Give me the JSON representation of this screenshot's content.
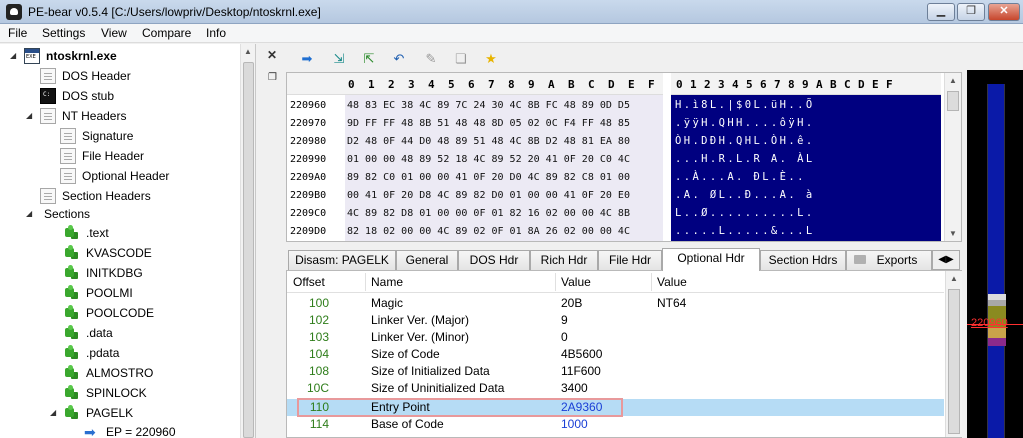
{
  "window": {
    "title": "PE-bear v0.5.4 [C:/Users/lowpriv/Desktop/ntoskrnl.exe]",
    "min_glyph": "▁",
    "max_glyph": "❐",
    "close_glyph": "✕"
  },
  "menu": [
    "File",
    "Settings",
    "View",
    "Compare",
    "Info"
  ],
  "tree": {
    "root": "ntoskrnl.exe",
    "items": [
      {
        "label": "DOS Header"
      },
      {
        "label": "DOS stub"
      },
      {
        "label": "NT Headers"
      },
      {
        "label": "Signature"
      },
      {
        "label": "File Header"
      },
      {
        "label": "Optional Header"
      },
      {
        "label": "Section Headers"
      },
      {
        "label": "Sections"
      },
      {
        "label": ".text"
      },
      {
        "label": "KVASCODE"
      },
      {
        "label": "INITKDBG"
      },
      {
        "label": "POOLMI"
      },
      {
        "label": "POOLCODE"
      },
      {
        "label": ".data"
      },
      {
        "label": ".pdata"
      },
      {
        "label": "ALMOSTRO"
      },
      {
        "label": "SPINLOCK"
      },
      {
        "label": "PAGELK"
      },
      {
        "label": "EP = 220960"
      }
    ]
  },
  "toolbar": {
    "icons": [
      "arrow-right-icon",
      "goto-icon",
      "export-icon",
      "undo-icon",
      "pin-icon",
      "copy-icon",
      "star-icon"
    ]
  },
  "hex": {
    "columns": [
      "0",
      "1",
      "2",
      "3",
      "4",
      "5",
      "6",
      "7",
      "8",
      "9",
      "A",
      "B",
      "C",
      "D",
      "E",
      "F"
    ],
    "rows": [
      {
        "addr": "220960",
        "bytes": "48 83 EC 38 4C 89 7C 24 30 4C 8B FC 48 89 0D D5",
        "ascii": "H.ì8L.|$0L.üH..Õ"
      },
      {
        "addr": "220970",
        "bytes": "9D FF FF 48 8B 51 48 48 8D 05 02 0C F4 FF 48 85",
        "ascii": ".ÿÿH.QHH....ôÿH."
      },
      {
        "addr": "220980",
        "bytes": "D2 48 0F 44 D0 48 89 51 48 4C 8B D2 48 81 EA 80",
        "ascii": "ÒH.DÐH.QHL.ÒH.ê."
      },
      {
        "addr": "220990",
        "bytes": "01 00 00 48 89 52 18 4C 89 52 20 41 0F 20 C0 4C",
        "ascii": "...H.R.L.R A. ÀL"
      },
      {
        "addr": "2209A0",
        "bytes": "89 82 C0 01 00 00 41 0F 20 D0 4C 89 82 C8 01 00",
        "ascii": "..À...A. ÐL.È.."
      },
      {
        "addr": "2209B0",
        "bytes": "00 41 0F 20 D8 4C 89 82 D0 01 00 00 41 0F 20 E0",
        "ascii": ".A. ØL..Ð...A. à"
      },
      {
        "addr": "2209C0",
        "bytes": "4C 89 82 D8 01 00 00 0F 01 82 16 02 00 00 4C 8B",
        "ascii": "L..Ø..........L."
      },
      {
        "addr": "2209D0",
        "bytes": "82 18 02 00 00 4C 89 02 0F 01 8A 26 02 00 00 4C",
        "ascii": ".....L.....&...L"
      }
    ]
  },
  "tabs": [
    {
      "label": "Disasm: PAGELK"
    },
    {
      "label": "General"
    },
    {
      "label": "DOS Hdr"
    },
    {
      "label": "Rich Hdr"
    },
    {
      "label": "File Hdr"
    },
    {
      "label": "Optional Hdr"
    },
    {
      "label": "Section Hdrs"
    },
    {
      "label": "Exports"
    }
  ],
  "table": {
    "headers": [
      "Offset",
      "Name",
      "Value",
      "Value"
    ],
    "rows": [
      {
        "offset": "100",
        "name": "Magic",
        "value": "20B",
        "value2": "NT64"
      },
      {
        "offset": "102",
        "name": "Linker Ver. (Major)",
        "value": "9",
        "value2": ""
      },
      {
        "offset": "103",
        "name": "Linker Ver. (Minor)",
        "value": "0",
        "value2": ""
      },
      {
        "offset": "104",
        "name": "Size of Code",
        "value": "4B5600",
        "value2": ""
      },
      {
        "offset": "108",
        "name": "Size of Initialized Data",
        "value": "11F600",
        "value2": ""
      },
      {
        "offset": "10C",
        "name": "Size of Uninitialized Data",
        "value": "3400",
        "value2": ""
      },
      {
        "offset": "110",
        "name": "Entry Point",
        "value": "2A9360",
        "value2": ""
      },
      {
        "offset": "114",
        "name": "Base of Code",
        "value": "1000",
        "value2": ""
      }
    ]
  },
  "overview": {
    "marker": "220960"
  },
  "colors": {
    "ascii_bg": "#000080",
    "offset_green": "#2e7d1a",
    "selected_row": "#b6dcf5",
    "marker_red": "#ff3030"
  }
}
